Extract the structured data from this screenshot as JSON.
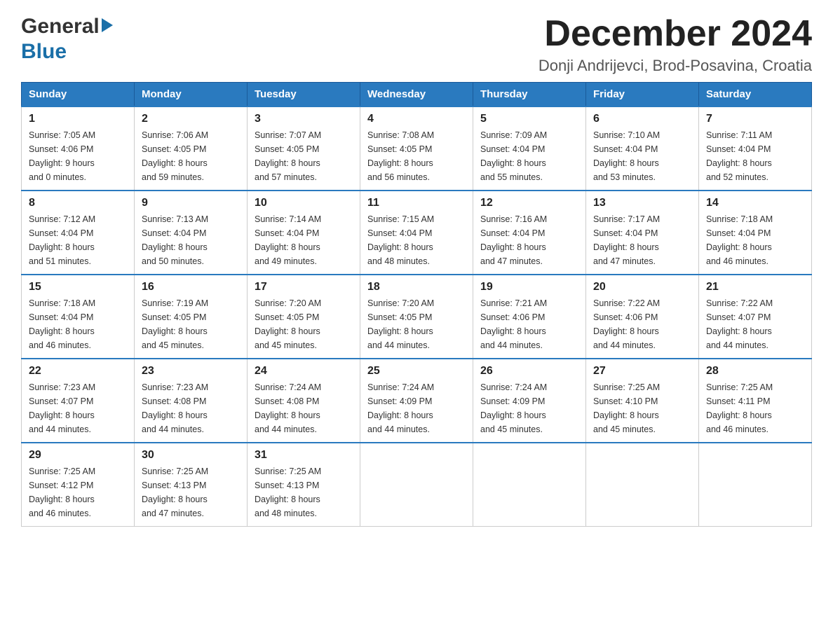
{
  "header": {
    "logo_general": "General",
    "logo_blue": "Blue",
    "month_title": "December 2024",
    "location": "Donji Andrijevci, Brod-Posavina, Croatia"
  },
  "days_of_week": [
    "Sunday",
    "Monday",
    "Tuesday",
    "Wednesday",
    "Thursday",
    "Friday",
    "Saturday"
  ],
  "weeks": [
    [
      {
        "day": "1",
        "sunrise": "7:05 AM",
        "sunset": "4:06 PM",
        "daylight": "9 hours and 0 minutes."
      },
      {
        "day": "2",
        "sunrise": "7:06 AM",
        "sunset": "4:05 PM",
        "daylight": "8 hours and 59 minutes."
      },
      {
        "day": "3",
        "sunrise": "7:07 AM",
        "sunset": "4:05 PM",
        "daylight": "8 hours and 57 minutes."
      },
      {
        "day": "4",
        "sunrise": "7:08 AM",
        "sunset": "4:05 PM",
        "daylight": "8 hours and 56 minutes."
      },
      {
        "day": "5",
        "sunrise": "7:09 AM",
        "sunset": "4:04 PM",
        "daylight": "8 hours and 55 minutes."
      },
      {
        "day": "6",
        "sunrise": "7:10 AM",
        "sunset": "4:04 PM",
        "daylight": "8 hours and 53 minutes."
      },
      {
        "day": "7",
        "sunrise": "7:11 AM",
        "sunset": "4:04 PM",
        "daylight": "8 hours and 52 minutes."
      }
    ],
    [
      {
        "day": "8",
        "sunrise": "7:12 AM",
        "sunset": "4:04 PM",
        "daylight": "8 hours and 51 minutes."
      },
      {
        "day": "9",
        "sunrise": "7:13 AM",
        "sunset": "4:04 PM",
        "daylight": "8 hours and 50 minutes."
      },
      {
        "day": "10",
        "sunrise": "7:14 AM",
        "sunset": "4:04 PM",
        "daylight": "8 hours and 49 minutes."
      },
      {
        "day": "11",
        "sunrise": "7:15 AM",
        "sunset": "4:04 PM",
        "daylight": "8 hours and 48 minutes."
      },
      {
        "day": "12",
        "sunrise": "7:16 AM",
        "sunset": "4:04 PM",
        "daylight": "8 hours and 47 minutes."
      },
      {
        "day": "13",
        "sunrise": "7:17 AM",
        "sunset": "4:04 PM",
        "daylight": "8 hours and 47 minutes."
      },
      {
        "day": "14",
        "sunrise": "7:18 AM",
        "sunset": "4:04 PM",
        "daylight": "8 hours and 46 minutes."
      }
    ],
    [
      {
        "day": "15",
        "sunrise": "7:18 AM",
        "sunset": "4:04 PM",
        "daylight": "8 hours and 46 minutes."
      },
      {
        "day": "16",
        "sunrise": "7:19 AM",
        "sunset": "4:05 PM",
        "daylight": "8 hours and 45 minutes."
      },
      {
        "day": "17",
        "sunrise": "7:20 AM",
        "sunset": "4:05 PM",
        "daylight": "8 hours and 45 minutes."
      },
      {
        "day": "18",
        "sunrise": "7:20 AM",
        "sunset": "4:05 PM",
        "daylight": "8 hours and 44 minutes."
      },
      {
        "day": "19",
        "sunrise": "7:21 AM",
        "sunset": "4:06 PM",
        "daylight": "8 hours and 44 minutes."
      },
      {
        "day": "20",
        "sunrise": "7:22 AM",
        "sunset": "4:06 PM",
        "daylight": "8 hours and 44 minutes."
      },
      {
        "day": "21",
        "sunrise": "7:22 AM",
        "sunset": "4:07 PM",
        "daylight": "8 hours and 44 minutes."
      }
    ],
    [
      {
        "day": "22",
        "sunrise": "7:23 AM",
        "sunset": "4:07 PM",
        "daylight": "8 hours and 44 minutes."
      },
      {
        "day": "23",
        "sunrise": "7:23 AM",
        "sunset": "4:08 PM",
        "daylight": "8 hours and 44 minutes."
      },
      {
        "day": "24",
        "sunrise": "7:24 AM",
        "sunset": "4:08 PM",
        "daylight": "8 hours and 44 minutes."
      },
      {
        "day": "25",
        "sunrise": "7:24 AM",
        "sunset": "4:09 PM",
        "daylight": "8 hours and 44 minutes."
      },
      {
        "day": "26",
        "sunrise": "7:24 AM",
        "sunset": "4:09 PM",
        "daylight": "8 hours and 45 minutes."
      },
      {
        "day": "27",
        "sunrise": "7:25 AM",
        "sunset": "4:10 PM",
        "daylight": "8 hours and 45 minutes."
      },
      {
        "day": "28",
        "sunrise": "7:25 AM",
        "sunset": "4:11 PM",
        "daylight": "8 hours and 46 minutes."
      }
    ],
    [
      {
        "day": "29",
        "sunrise": "7:25 AM",
        "sunset": "4:12 PM",
        "daylight": "8 hours and 46 minutes."
      },
      {
        "day": "30",
        "sunrise": "7:25 AM",
        "sunset": "4:13 PM",
        "daylight": "8 hours and 47 minutes."
      },
      {
        "day": "31",
        "sunrise": "7:25 AM",
        "sunset": "4:13 PM",
        "daylight": "8 hours and 48 minutes."
      },
      null,
      null,
      null,
      null
    ]
  ]
}
